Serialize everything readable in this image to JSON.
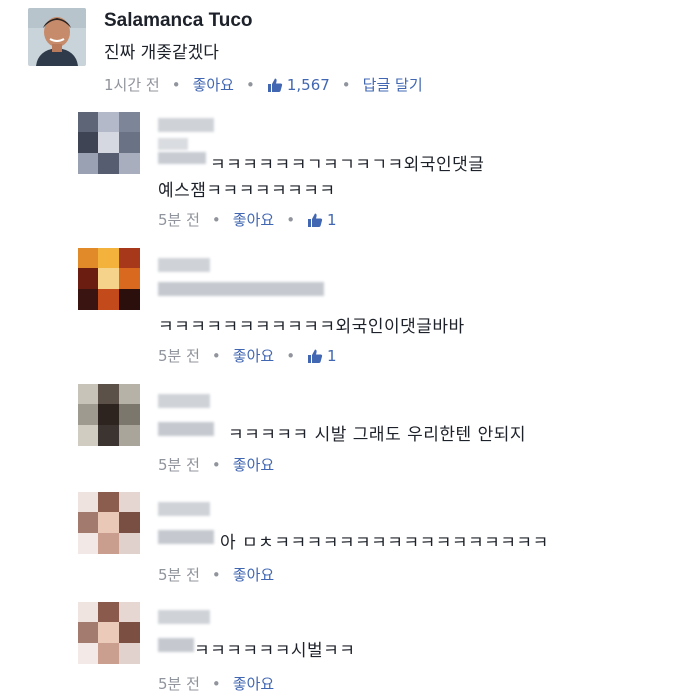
{
  "post": {
    "author": "Salamanca Tuco",
    "text": "진짜 개좆같겠다",
    "time": "1시간 전",
    "like_label": "좋아요",
    "like_count": "1,567",
    "reply_label": "답글 달기"
  },
  "comments": [
    {
      "line1": "ㅋㅋㅋㅋㅋㅋㄱㅋㄱㅋㄱㅋ외국인댓글",
      "line2": "예스잼ㅋㅋㅋㅋㅋㅋㅋㅋ",
      "time": "5분 전",
      "like_label": "좋아요",
      "like_count": "1"
    },
    {
      "line1": "ㅋㅋㅋㅋㅋㅋㅋㅋㅋㅋㅋ외국인이댓글바바",
      "time": "5분 전",
      "like_label": "좋아요",
      "like_count": "1"
    },
    {
      "line1": "ㅋㅋㅋㅋㅋ 시발 그래도 우리한텐 안되지",
      "time": "5분 전",
      "like_label": "좋아요"
    },
    {
      "line1": "아 ㅁㅊㅋㅋㅋㅋㅋㅋㅋㅋㅋㅋㅋㅋㅋㅋㅋㅋㅋ",
      "time": "5분 전",
      "like_label": "좋아요"
    },
    {
      "line1": "ㅋㅋㅋㅋㅋㅋ시벌ㅋㅋ",
      "time": "5분 전",
      "like_label": "좋아요"
    }
  ],
  "colors": {
    "link": "#4267b2",
    "meta": "#90949c",
    "text": "#1d2129"
  },
  "icons": {
    "like": "thumbs-up-icon"
  }
}
